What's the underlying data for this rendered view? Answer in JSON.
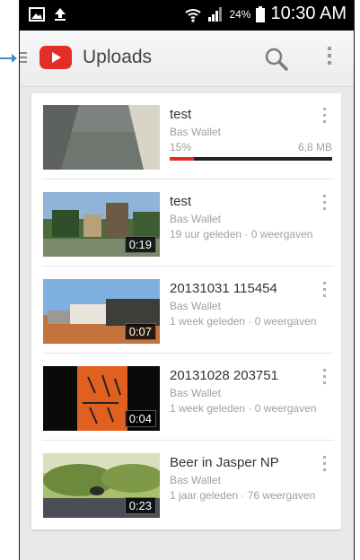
{
  "statusbar": {
    "battery_percent": "24%",
    "time": "10:30 AM",
    "icons": [
      "gallery-icon",
      "upload-icon",
      "wifi-icon",
      "signal-icon",
      "battery-icon"
    ]
  },
  "actionbar": {
    "title": "Uploads",
    "icons": [
      "menu-icon",
      "youtube-logo",
      "search-icon",
      "overflow-menu-icon"
    ]
  },
  "videos": [
    {
      "title": "test",
      "author": "Bas Wallet",
      "uploading": true,
      "progress_label": "15%",
      "progress_fraction": 0.15,
      "size": "6,8 MB",
      "duration": "",
      "meta": ""
    },
    {
      "title": "test",
      "author": "Bas Wallet",
      "duration": "0:19",
      "meta": "19 uur geleden · 0 weergaven"
    },
    {
      "title": "20131031 115454",
      "author": "Bas Wallet",
      "duration": "0:07",
      "meta": "1 week geleden · 0 weergaven"
    },
    {
      "title": "20131028 203751",
      "author": "Bas Wallet",
      "duration": "0:04",
      "meta": "1 week geleden · 0 weergaven"
    },
    {
      "title": "Beer in Jasper NP",
      "author": "Bas Wallet",
      "duration": "0:23",
      "meta": "1 jaar geleden · 76 weergaven"
    }
  ],
  "colors": {
    "accent": "#e52d27",
    "callout": "#3a8fd0"
  }
}
